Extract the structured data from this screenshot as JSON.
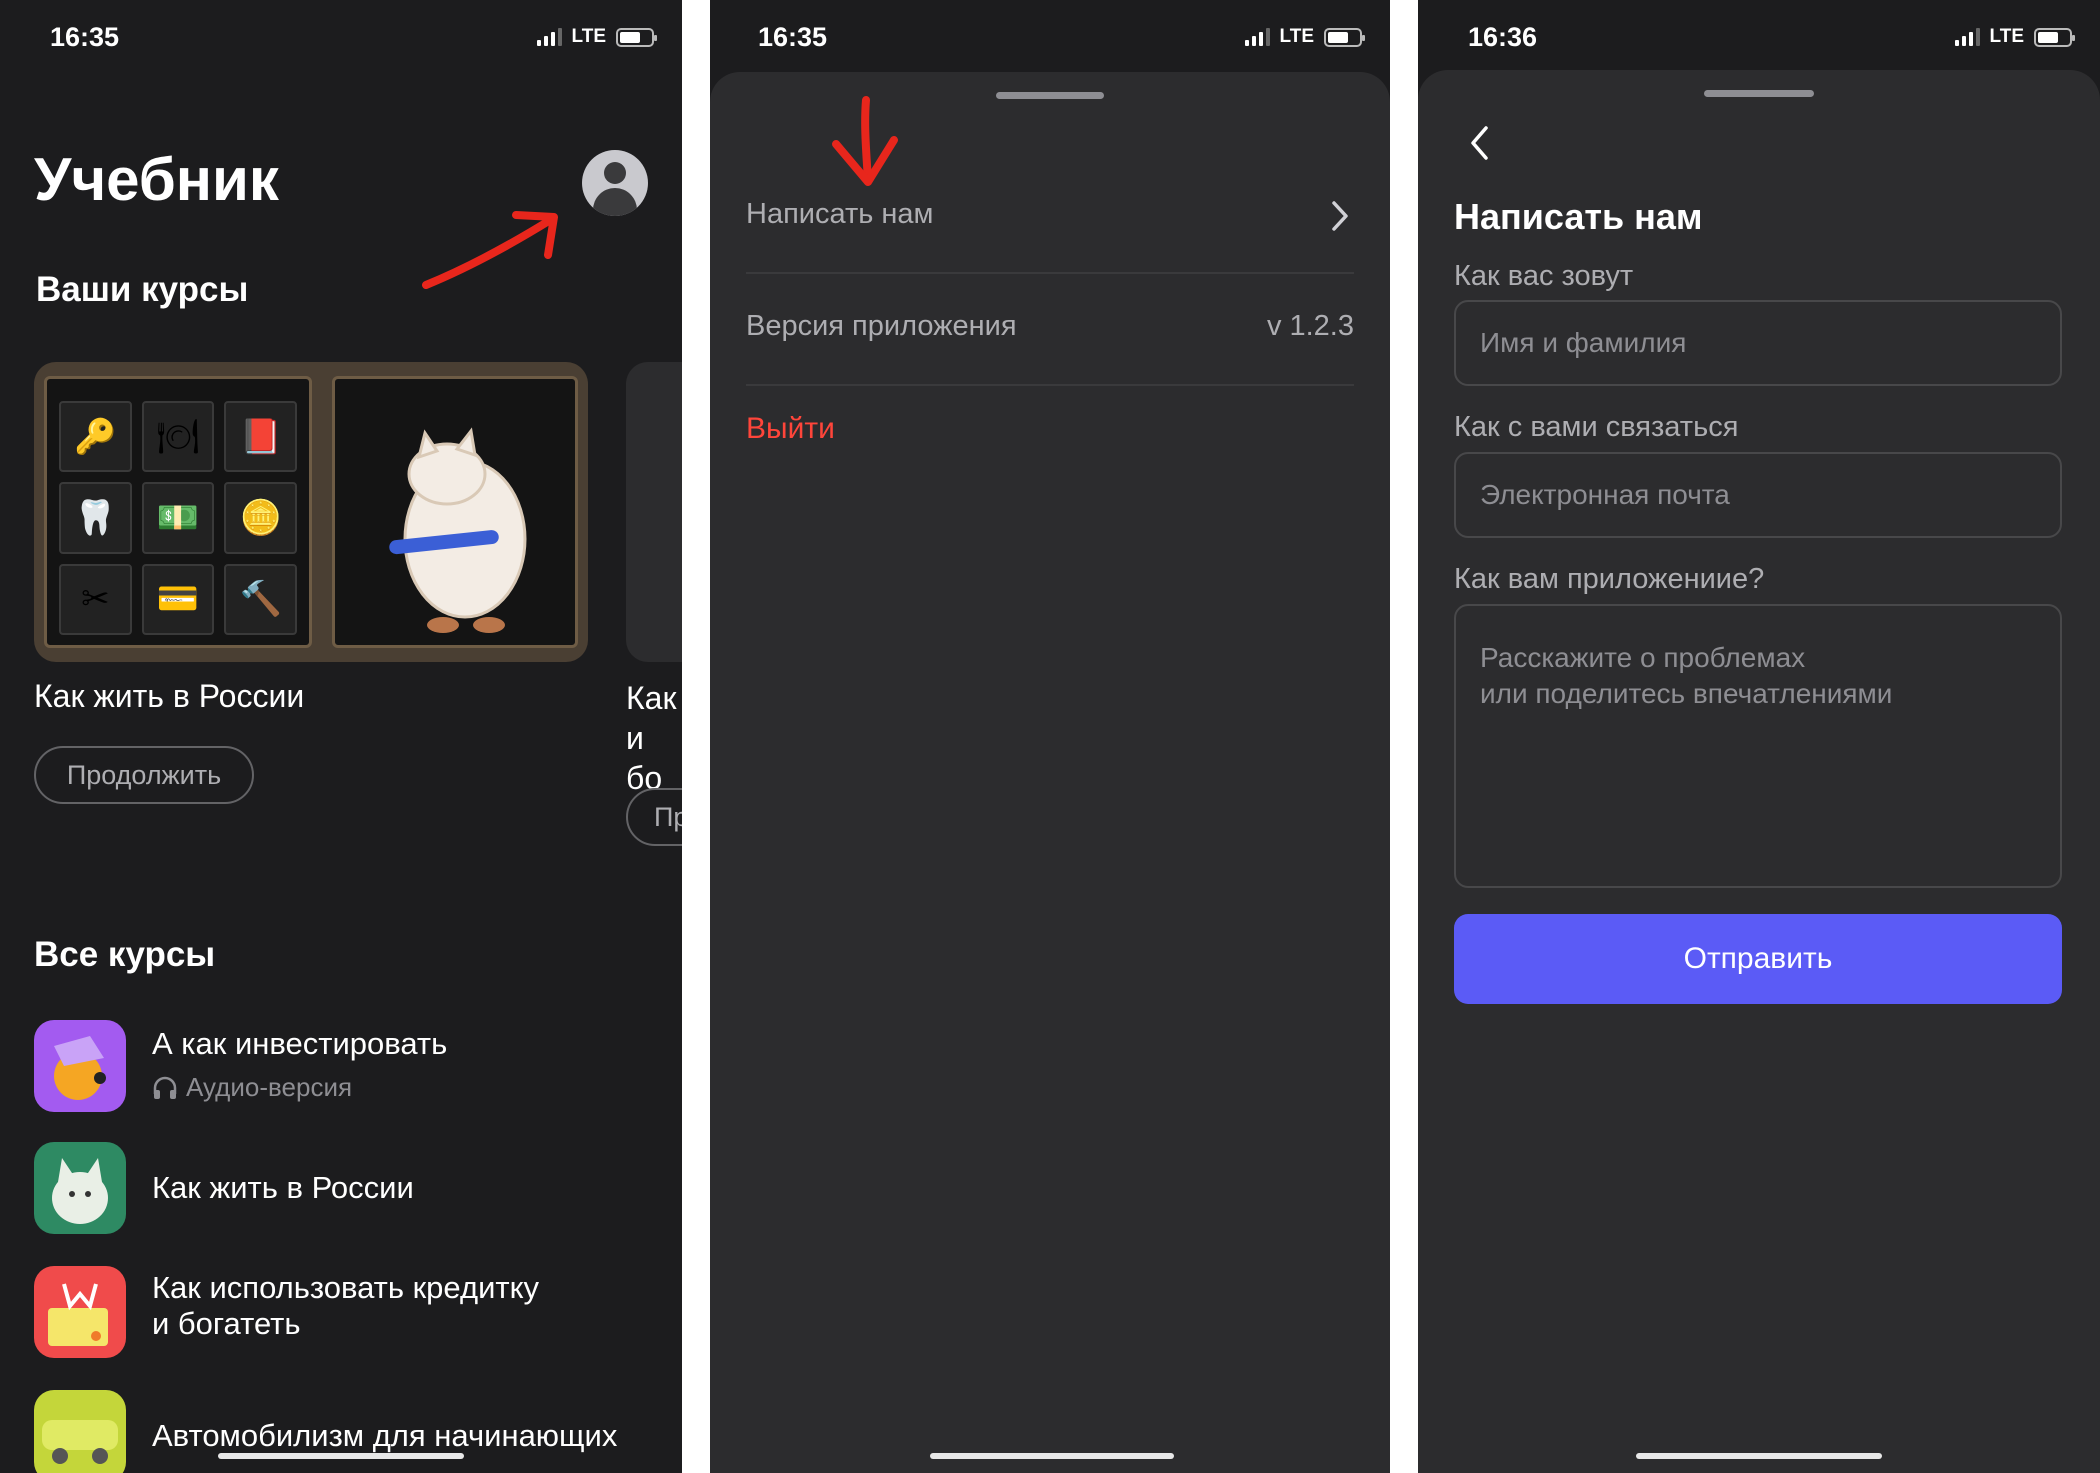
{
  "screens": [
    {
      "status": {
        "time": "16:35",
        "network": "LTE"
      },
      "title": "Учебник",
      "your_courses_heading": "Ваши курсы",
      "featured_course": {
        "name": "Как жить в России",
        "button": "Продолжить"
      },
      "peek_course": {
        "name_line1": "Как",
        "name_line2": "и бо",
        "button": "Пр"
      },
      "all_courses_heading": "Все курсы",
      "courses": [
        {
          "title": "А как инвестировать",
          "subtitle": "Аудио-версия",
          "icon": "investing-icon",
          "color": "#a35bf0"
        },
        {
          "title": "Как жить в России",
          "icon": "cat-icon",
          "color": "#2e8a63"
        },
        {
          "title_line1": "Как использовать кредитку",
          "title_line2": "и богатеть",
          "icon": "credit-card-icon",
          "color": "#f04b4b"
        },
        {
          "title": "Автомобилизм для начинающих",
          "icon": "car-icon",
          "color": "#c4d63a"
        }
      ]
    },
    {
      "status": {
        "time": "16:35",
        "network": "LTE"
      },
      "menu": {
        "write_us": "Написать нам",
        "app_version_label": "Версия приложения",
        "app_version_value": "v 1.2.3",
        "logout": "Выйти"
      }
    },
    {
      "status": {
        "time": "16:36",
        "network": "LTE"
      },
      "title": "Написать нам",
      "form": {
        "name_label": "Как вас зовут",
        "name_placeholder": "Имя и фамилия",
        "contact_label": "Как с вами связаться",
        "contact_placeholder": "Электронная почта",
        "feedback_label": "Как вам приложениие?",
        "feedback_placeholder_line1": "Расскажите о проблемах",
        "feedback_placeholder_line2": "или поделитесь впечатлениями",
        "submit": "Отправить"
      }
    }
  ],
  "colors": {
    "background": "#1c1c1e",
    "sheet": "#2c2c2e",
    "accent": "#5b5bf6",
    "danger": "#ff453a",
    "annotation": "#e8261c"
  }
}
